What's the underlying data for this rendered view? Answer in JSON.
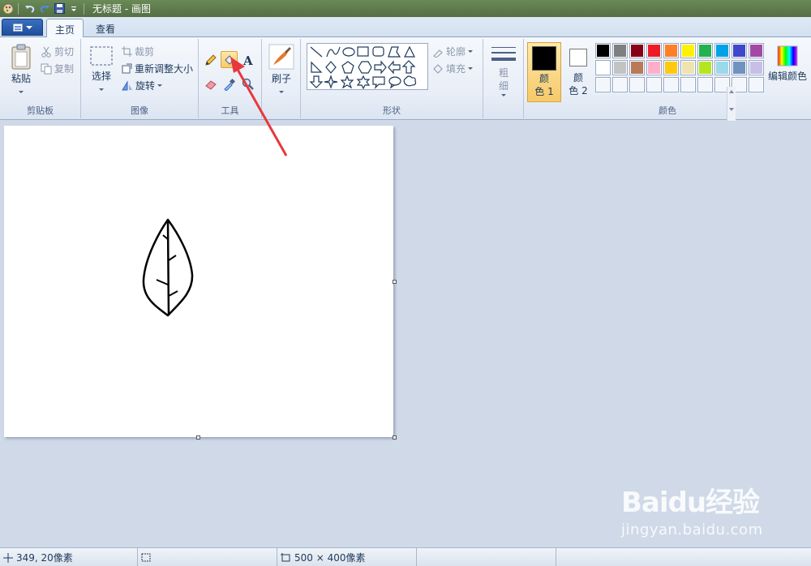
{
  "window": {
    "title": "无标题 - 画图"
  },
  "tabs": [
    {
      "label": "主页",
      "active": true
    },
    {
      "label": "查看",
      "active": false
    }
  ],
  "ribbon": {
    "clipboard": {
      "paste_label": "粘贴",
      "cut_label": "剪切",
      "copy_label": "复制",
      "group_label": "剪贴板"
    },
    "image": {
      "select_label": "选择",
      "crop_label": "裁剪",
      "resize_label": "重新调整大小",
      "rotate_label": "旋转",
      "group_label": "图像"
    },
    "tools": {
      "group_label": "工具",
      "active_tool": "fill-bucket"
    },
    "brushes": {
      "label": "刷子"
    },
    "shapes": {
      "outline_label": "轮廓",
      "fill_label": "填充",
      "group_label": "形状"
    },
    "size": {
      "label": "粗\n细"
    },
    "colors": {
      "color1_label": "颜\n色 1",
      "color2_label": "颜\n色 2",
      "color1": "#000000",
      "color2": "#ffffff",
      "edit_label": "编辑颜色",
      "group_label": "颜色",
      "palette_row1": [
        "#000000",
        "#7f7f7f",
        "#880015",
        "#ed1c24",
        "#ff7f27",
        "#fff200",
        "#22b14c",
        "#00a2e8",
        "#3f48cc",
        "#a349a4"
      ],
      "palette_row2": [
        "#ffffff",
        "#c3c3c3",
        "#b97a57",
        "#ffaec9",
        "#ffc90e",
        "#efe4b0",
        "#b5e61d",
        "#99d9ea",
        "#7092be",
        "#c8bfe7"
      ],
      "palette_row3_count": 10
    }
  },
  "statusbar": {
    "cursor_pos": "349, 20像素",
    "selection_size": "",
    "canvas_size": "500 × 400像素"
  },
  "watermark": {
    "main": "Baidu经验",
    "sub": "jingyan.baidu.com"
  }
}
